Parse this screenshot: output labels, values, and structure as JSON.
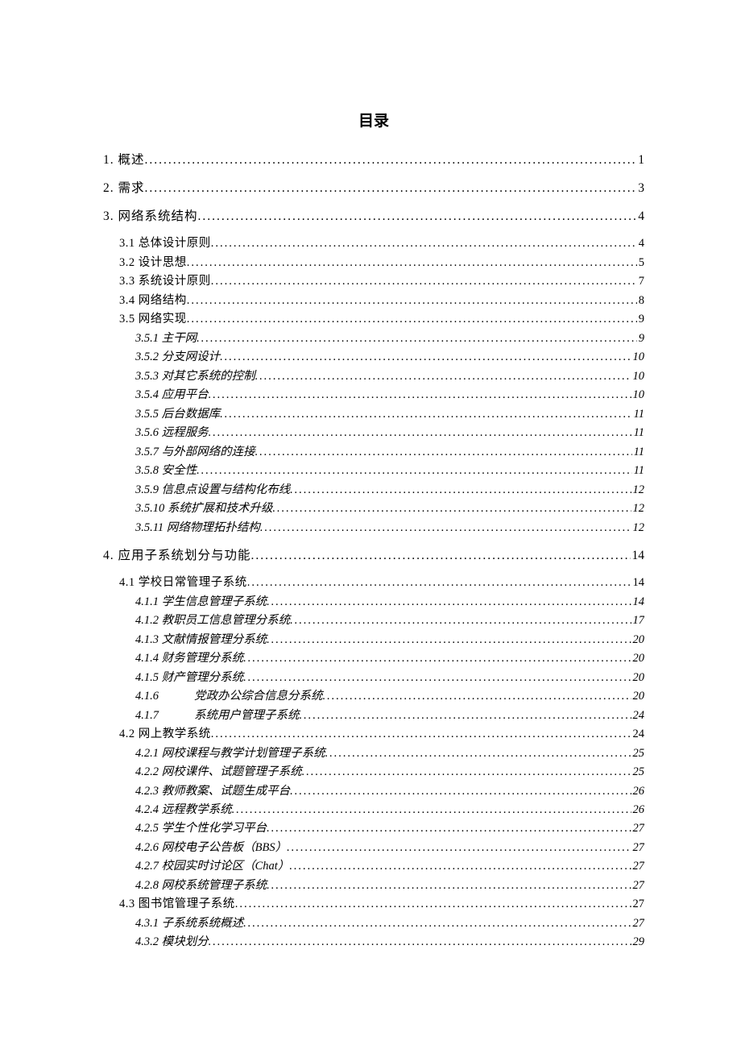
{
  "title": "目录",
  "entries": [
    {
      "level": 1,
      "label": "1. 概述",
      "page": "1"
    },
    {
      "level": 1,
      "label": "2. 需求",
      "page": "3"
    },
    {
      "level": 1,
      "label": "3. 网络系统结构",
      "page": "4"
    },
    {
      "level": 2,
      "label": "3.1  总体设计原则",
      "page": "4"
    },
    {
      "level": 2,
      "label": "3.2  设计思想",
      "page": "5"
    },
    {
      "level": 2,
      "label": "3.3 系统设计原则",
      "page": "7"
    },
    {
      "level": 2,
      "label": "3.4 网络结构",
      "page": "8"
    },
    {
      "level": 2,
      "label": "3.5 网络实现",
      "page": "9"
    },
    {
      "level": 3,
      "label": "3.5.1  主干网",
      "page": "9"
    },
    {
      "level": 3,
      "label": "3.5.2  分支网设计",
      "page": "10"
    },
    {
      "level": 3,
      "label": "3.5.3  对其它系统的控制",
      "page": "10"
    },
    {
      "level": 3,
      "label": "3.5.4  应用平台",
      "page": "10"
    },
    {
      "level": 3,
      "label": "3.5.5  后台数据库",
      "page": "11"
    },
    {
      "level": 3,
      "label": "3.5.6  远程服务",
      "page": "11"
    },
    {
      "level": 3,
      "label": "3.5.7  与外部网络的连接",
      "page": "11"
    },
    {
      "level": 3,
      "label": "3.5.8 安全性",
      "page": "11"
    },
    {
      "level": 3,
      "label": "3.5.9 信息点设置与结构化布线",
      "page": "12"
    },
    {
      "level": 3,
      "label": "3.5.10 系统扩展和技术升级",
      "page": "12"
    },
    {
      "level": 3,
      "label": "3.5.11 网络物理拓扑结构",
      "page": "12"
    },
    {
      "level": 1,
      "label": "4. 应用子系统划分与功能",
      "page": "14"
    },
    {
      "level": 2,
      "label": "4.1  学校日常管理子系统",
      "page": "14"
    },
    {
      "level": 3,
      "label": "4.1.1  学生信息管理子系统",
      "page": "14"
    },
    {
      "level": 3,
      "label": "4.1.2  教职员工信息管理分系统",
      "page": "17"
    },
    {
      "level": 3,
      "label": "4.1.3  文献情报管理分系统",
      "page": "20"
    },
    {
      "level": 3,
      "label": "4.1.4  财务管理分系统",
      "page": "20"
    },
    {
      "level": 3,
      "label": "4.1.5   财产管理分系统",
      "page": "20"
    },
    {
      "level": 3,
      "label": "4.1.6",
      "label2": "党政办公综合信息分系统",
      "page": "20",
      "extra_indent": true
    },
    {
      "level": 3,
      "label": "4.1.7",
      "label2": "系统用户管理子系统",
      "page": "24",
      "extra_indent": true
    },
    {
      "level": 2,
      "label": "4.2  网上教学系统",
      "page": "24"
    },
    {
      "level": 3,
      "label": "4.2.1 网校课程与教学计划管理子系统",
      "page": "25"
    },
    {
      "level": 3,
      "label": "4.2.2 网校课件、试题管理子系统",
      "page": "25"
    },
    {
      "level": 3,
      "label": "4.2.3 教师教案、试题生成平台",
      "page": "26"
    },
    {
      "level": 3,
      "label": "4.2.4  远程教学系统",
      "page": "26"
    },
    {
      "level": 3,
      "label": "4.2.5 学生个性化学习平台",
      "page": "27"
    },
    {
      "level": 3,
      "label": "4.2.6 网校电子公告板（BBS）",
      "page": "27"
    },
    {
      "level": 3,
      "label": "4.2.7 校园实时讨论区（Chat）",
      "page": "27"
    },
    {
      "level": 3,
      "label": "4.2.8 网校系统管理子系统",
      "page": "27"
    },
    {
      "level": 2,
      "label": "4.3 图书馆管理子系统",
      "page": "27"
    },
    {
      "level": 3,
      "label": "4.3.1 子系统系统概述",
      "page": "27"
    },
    {
      "level": 3,
      "label": "4.3.2 模块划分",
      "page": "29"
    }
  ]
}
